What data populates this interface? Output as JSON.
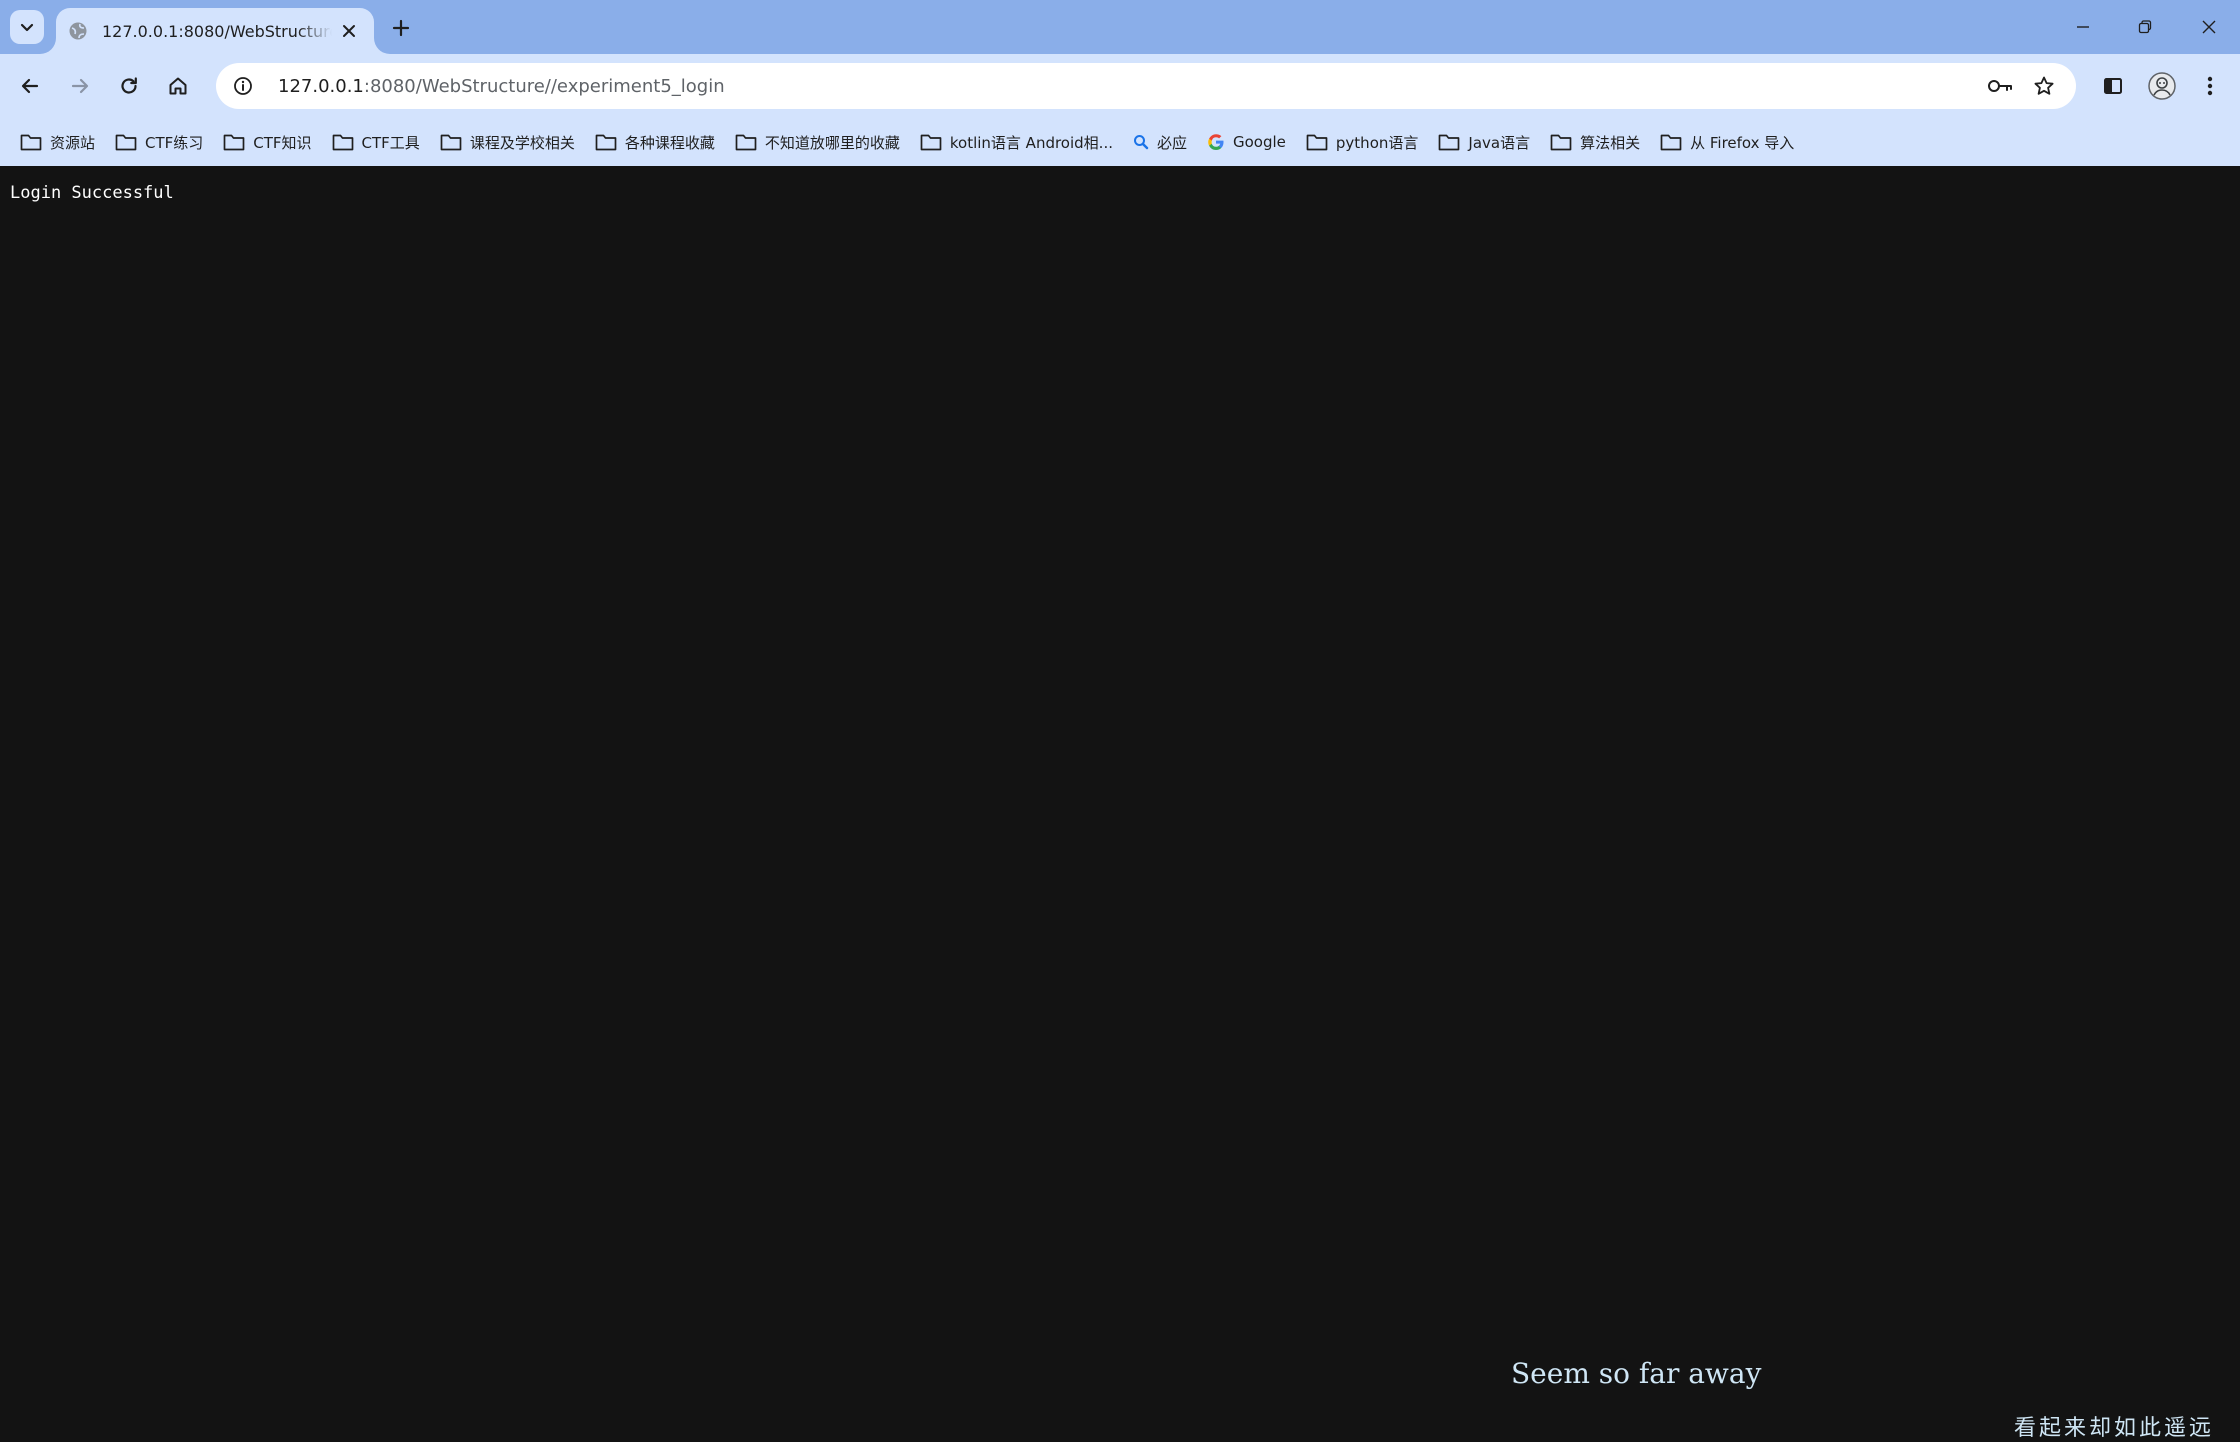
{
  "browser": {
    "tab": {
      "title": "127.0.0.1:8080/WebStructure//experiment5_login"
    },
    "address_bar": {
      "host": "127.0.0.1",
      "rest": ":8080/WebStructure//experiment5_login"
    },
    "bookmarks": [
      {
        "label": "资源站",
        "icon": "folder-icon"
      },
      {
        "label": "CTF练习",
        "icon": "folder-icon"
      },
      {
        "label": "CTF知识",
        "icon": "folder-icon"
      },
      {
        "label": "CTF工具",
        "icon": "folder-icon"
      },
      {
        "label": "课程及学校相关",
        "icon": "folder-icon"
      },
      {
        "label": "各种课程收藏",
        "icon": "folder-icon"
      },
      {
        "label": "不知道放哪里的收藏",
        "icon": "folder-icon"
      },
      {
        "label": "kotlin语言 Android相...",
        "icon": "folder-icon"
      },
      {
        "label": "必应",
        "icon": "search-icon"
      },
      {
        "label": "Google",
        "icon": "google-icon"
      },
      {
        "label": "python语言",
        "icon": "folder-icon"
      },
      {
        "label": "Java语言",
        "icon": "folder-icon"
      },
      {
        "label": "算法相关",
        "icon": "folder-icon"
      },
      {
        "label": "从 Firefox 导入",
        "icon": "folder-icon"
      }
    ],
    "colors": {
      "tabstrip": "#8aaee9",
      "toolbar": "#d3e3fd",
      "page_bg": "#131313"
    }
  },
  "page": {
    "message": "Login Successful",
    "lyric_en": "Seem so far away",
    "lyric_cn": "看起来却如此遥远"
  }
}
